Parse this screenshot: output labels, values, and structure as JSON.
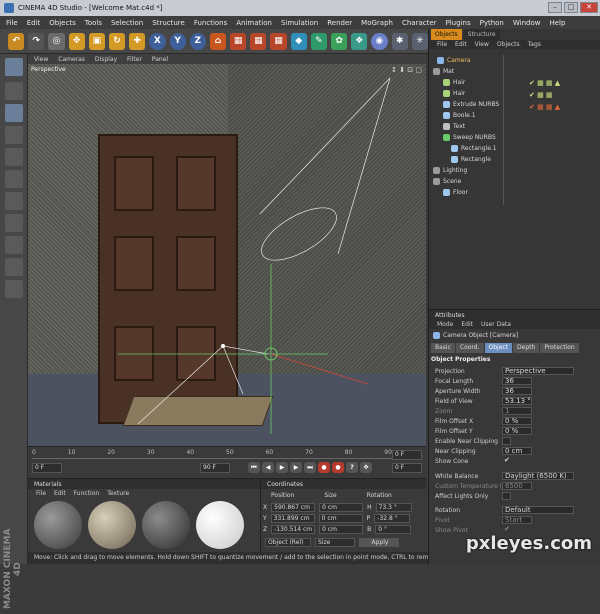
{
  "window": {
    "title": "CINEMA 4D Studio - [Welcome Mat.c4d *]"
  },
  "menu": [
    "File",
    "Edit",
    "Objects",
    "Tools",
    "Selection",
    "Structure",
    "Functions",
    "Animation",
    "Simulation",
    "Render",
    "MoGraph",
    "Character",
    "Plugins",
    "Python",
    "Window",
    "Help"
  ],
  "viewport": {
    "menu": [
      "View",
      "Cameras",
      "Display",
      "Filter",
      "Panel"
    ],
    "label": "Perspective"
  },
  "timeline": {
    "ticks": [
      "0",
      "10",
      "20",
      "30",
      "40",
      "50",
      "60",
      "70",
      "80",
      "90"
    ],
    "current_frame": "0 F",
    "start_field": "0 F",
    "end_field": "90 F",
    "end_field2": "0 F"
  },
  "materials": {
    "title": "Materials",
    "menu": [
      "File",
      "Edit",
      "Function",
      "Texture"
    ]
  },
  "coordinates": {
    "title": "Coordinates",
    "headers": [
      "Position",
      "Size",
      "Rotation"
    ],
    "rows": [
      {
        "axis": "X",
        "pos": "590.867 cm",
        "size": "0 cm",
        "rot_label": "H",
        "rot": "73.3 °"
      },
      {
        "axis": "Y",
        "pos": "331.899 cm",
        "size": "0 cm",
        "rot_label": "P",
        "rot": "-32.8 °"
      },
      {
        "axis": "Z",
        "pos": "-130.514 cm",
        "size": "0 cm",
        "rot_label": "B",
        "rot": "0 °"
      }
    ],
    "mode": "Object (Rel)",
    "size_mode": "Size",
    "apply": "Apply"
  },
  "status": "Move: Click and drag to move elements. Hold down SHIFT to quantize movement / add to the selection in point mode, CTRL to remove.",
  "objects": {
    "tabs": [
      "Objects",
      "Structure"
    ],
    "menu": [
      "File",
      "Edit",
      "View",
      "Objects",
      "Tags"
    ],
    "items": [
      {
        "name": "Camera",
        "color": "#8fb6e8"
      },
      {
        "name": "Mat",
        "color": "#e0e0e0"
      },
      {
        "name": "Hair",
        "color": "#a8d27a"
      },
      {
        "name": "Hair",
        "color": "#a8d27a"
      },
      {
        "name": "Extrude NURBS",
        "color": "#9ec7ee"
      },
      {
        "name": "Boole.1",
        "color": "#9ec7ee"
      },
      {
        "name": "Text",
        "color": "#e0e0e0"
      },
      {
        "name": "Sweep NURBS",
        "color": "#9ec7ee"
      },
      {
        "name": "Rectangle.1",
        "color": "#9ec7ee"
      },
      {
        "name": "Rectangle",
        "color": "#9ec7ee"
      },
      {
        "name": "Lighting",
        "color": "#e0e0e0"
      },
      {
        "name": "Scene",
        "color": "#e0e0e0"
      },
      {
        "name": "Floor",
        "color": "#9ec7ee"
      }
    ]
  },
  "attributes": {
    "title": "Attributes",
    "menu": [
      "Mode",
      "Edit",
      "User Data"
    ],
    "object_label": "Camera Object [Camera]",
    "tabs": [
      "Basic",
      "Coord.",
      "Object",
      "Depth",
      "Protection"
    ],
    "section": "Object Properties",
    "rows": [
      {
        "label": "Projection",
        "value": "Perspective"
      },
      {
        "label": "Focal Length",
        "value": "36"
      },
      {
        "label": "Aperture Width",
        "value": "36"
      },
      {
        "label": "Field of View",
        "value": "53.13 °"
      },
      {
        "label": "Zoom",
        "value": "1"
      },
      {
        "label": "Film Offset X",
        "value": "0 %"
      },
      {
        "label": "Film Offset Y",
        "value": "0 %"
      },
      {
        "label": "Enable Near Clipping",
        "value": ""
      },
      {
        "label": "Near Clipping",
        "value": "0 cm"
      },
      {
        "label": "Show Cone",
        "value": "✔"
      },
      {
        "label": "White Balance",
        "value": "Daylight (6500 K)"
      },
      {
        "label": "Custom Temperature (K)",
        "value": "6500"
      },
      {
        "label": "Affect Lights Only",
        "value": ""
      },
      {
        "label": "Rotation",
        "value": "Default"
      },
      {
        "label": "Pivot",
        "value": "Start"
      },
      {
        "label": "Show Pivot",
        "value": "✔"
      }
    ]
  },
  "watermark": "pxleyes.com"
}
